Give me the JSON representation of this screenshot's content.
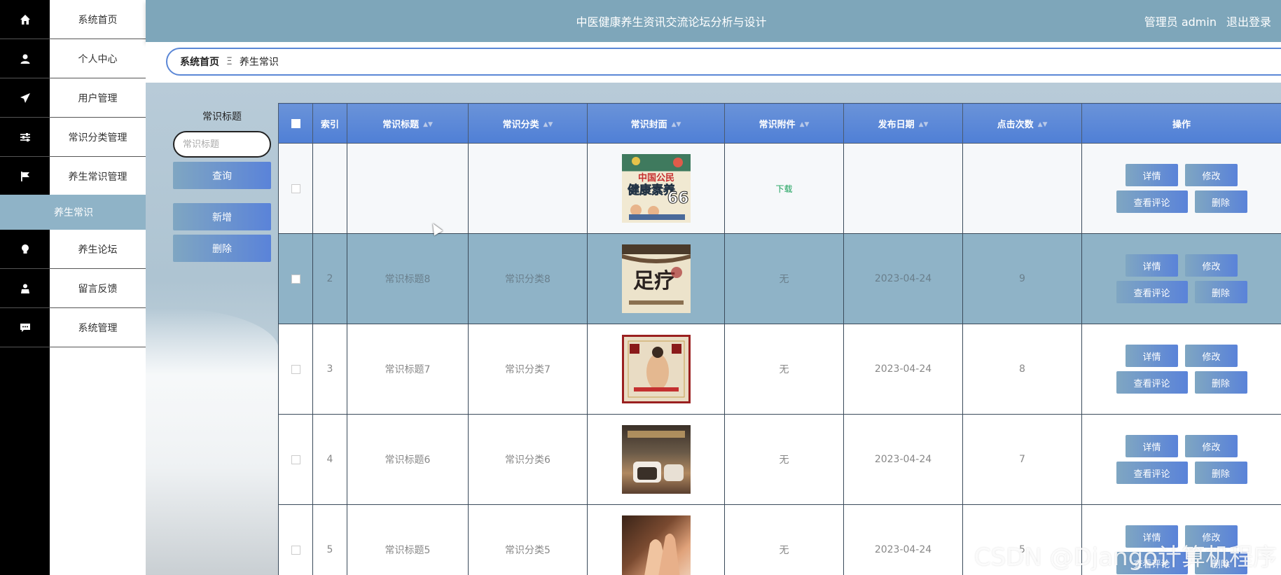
{
  "header": {
    "title": "中医健康养生资讯交流论坛分析与设计",
    "admin_label": "管理员 admin",
    "logout_label": "退出登录"
  },
  "sidebar": {
    "items": [
      {
        "label": "系统首页",
        "icon": "home-icon"
      },
      {
        "label": "个人中心",
        "icon": "user-icon"
      },
      {
        "label": "用户管理",
        "icon": "send-icon"
      },
      {
        "label": "常识分类管理",
        "icon": "sliders-icon"
      },
      {
        "label": "养生常识管理",
        "icon": "flag-icon"
      },
      {
        "label": "养生论坛",
        "icon": "bulb-icon"
      },
      {
        "label": "留言反馈",
        "icon": "person-icon"
      },
      {
        "label": "系统管理",
        "icon": "chat-icon"
      }
    ],
    "active_sub": "养生常识"
  },
  "breadcrumb": {
    "home": "系统首页",
    "separator": "Ξ",
    "current": "养生常识"
  },
  "search": {
    "label": "常识标题",
    "placeholder": "常识标题",
    "query_label": "查询",
    "add_label": "新增",
    "delete_label": "删除"
  },
  "table": {
    "columns": [
      "索引",
      "常识标题",
      "常识分类",
      "常识封面",
      "常识附件",
      "发布日期",
      "点击次数",
      "操作"
    ],
    "rows": [
      {
        "index": "",
        "title": "",
        "category": "",
        "attachment": "下载",
        "date": "",
        "clicks": ""
      },
      {
        "index": "2",
        "title": "常识标题8",
        "category": "常识分类8",
        "attachment": "无",
        "date": "2023-04-24",
        "clicks": "9"
      },
      {
        "index": "3",
        "title": "常识标题7",
        "category": "常识分类7",
        "attachment": "无",
        "date": "2023-04-24",
        "clicks": "8"
      },
      {
        "index": "4",
        "title": "常识标题6",
        "category": "常识分类6",
        "attachment": "无",
        "date": "2023-04-24",
        "clicks": "7"
      },
      {
        "index": "5",
        "title": "常识标题5",
        "category": "常识分类5",
        "attachment": "无",
        "date": "2023-04-24",
        "clicks": "5"
      }
    ],
    "ops": {
      "detail": "详情",
      "edit": "修改",
      "comments": "查看评论",
      "delete": "删除"
    }
  },
  "covers": {
    "cover1_text": "中国公民健康素养66",
    "cover2_text": "足疗"
  },
  "watermark": "CSDN @Django计算机程序"
}
